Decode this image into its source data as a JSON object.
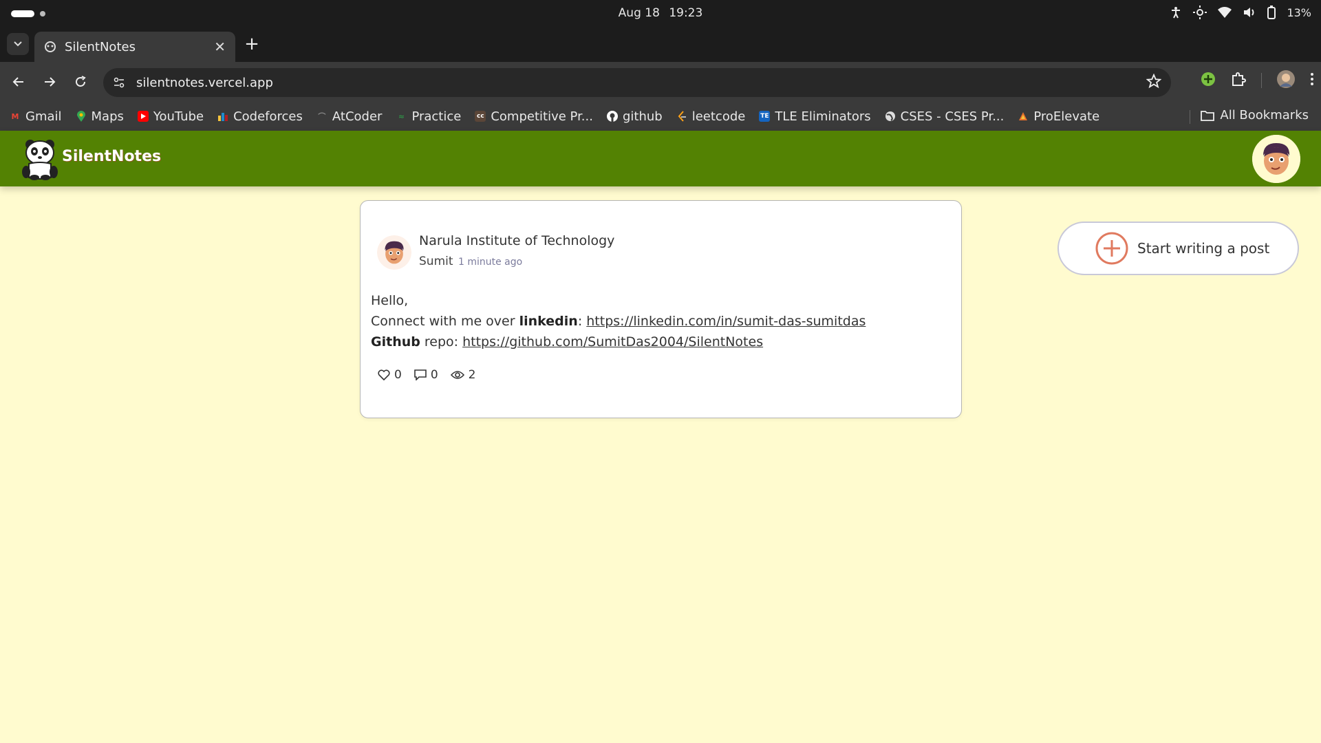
{
  "os": {
    "date": "Aug 18",
    "time": "19:23",
    "battery": "13%"
  },
  "browser": {
    "tab_title": "SilentNotes",
    "url": "silentnotes.vercel.app",
    "bookmarks": [
      {
        "label": "Gmail",
        "icon": "gmail-icon",
        "color": "#ea4335"
      },
      {
        "label": "Maps",
        "icon": "maps-icon",
        "color": "#34a853"
      },
      {
        "label": "YouTube",
        "icon": "youtube-icon",
        "color": "#ff0000"
      },
      {
        "label": "Codeforces",
        "icon": "codeforces-icon",
        "color": "#1f8acb"
      },
      {
        "label": "AtCoder",
        "icon": "atcoder-icon",
        "color": "#666666"
      },
      {
        "label": "Practice",
        "icon": "practice-icon",
        "color": "#2f8d46"
      },
      {
        "label": "Competitive Pr...",
        "icon": "codechef-icon",
        "color": "#5b4638"
      },
      {
        "label": "github",
        "icon": "github-icon",
        "color": "#ffffff"
      },
      {
        "label": "leetcode",
        "icon": "leetcode-icon",
        "color": "#ffa116"
      },
      {
        "label": "TLE Eliminators",
        "icon": "tle-icon",
        "color": "#1565c0"
      },
      {
        "label": "CSES - CSES Pr...",
        "icon": "globe-icon",
        "color": "#dddddd"
      },
      {
        "label": "ProElevate",
        "icon": "proelevate-icon",
        "color": "#e8702a"
      }
    ],
    "all_bookmarks": "All Bookmarks"
  },
  "app": {
    "brand": "SilentNotes",
    "header_color": "#538203",
    "background": "#fffbcf"
  },
  "post": {
    "organization": "Narula Institute of Technology",
    "author": "Sumit",
    "time_ago": "1 minute ago",
    "greeting": "Hello,",
    "line1_prefix": "Connect with me over ",
    "line1_bold": "linkedin",
    "line1_sep": ": ",
    "line1_link": "https://linkedin.com/in/sumit-das-sumitdas",
    "line2_bold": "Github",
    "line2_text": " repo: ",
    "line2_link": "https://github.com/SumitDas2004/SilentNotes",
    "likes": "0",
    "comments": "0",
    "views": "2"
  },
  "sidebar": {
    "write_label": "Start writing a post",
    "accent": "#e07a5f"
  }
}
